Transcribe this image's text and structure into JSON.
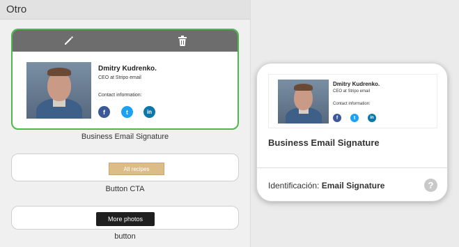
{
  "section": {
    "title": "Otro"
  },
  "templates": [
    {
      "caption": "Business Email Signature",
      "signature": {
        "name": "Dmitry Kudrenko.",
        "title": "CEO at Stripo email",
        "contact": "Contact information:",
        "social": [
          "f",
          "t",
          "in"
        ]
      },
      "selected": true,
      "tools": [
        "pencil-icon",
        "trash-icon"
      ]
    },
    {
      "caption": "Button CTA",
      "button_label": "All recipes"
    },
    {
      "caption": "button",
      "button_label": "More photos"
    }
  ],
  "popup": {
    "title": "Business Email Signature",
    "id_label": "Identificación:",
    "id_value": "Email Signature",
    "help": "?",
    "signature": {
      "name": "Dmitry Kudrenko.",
      "title": "CEO at Stripo email",
      "contact": "Contact information:"
    }
  },
  "colors": {
    "selected_border": "#4cb94a",
    "toolbar": "#6d6d6d",
    "cta_button": "#dcbd87",
    "dark_button": "#1f1f1f",
    "facebook": "#3b5998",
    "twitter": "#1da1f2",
    "linkedin": "#0e76a8"
  }
}
